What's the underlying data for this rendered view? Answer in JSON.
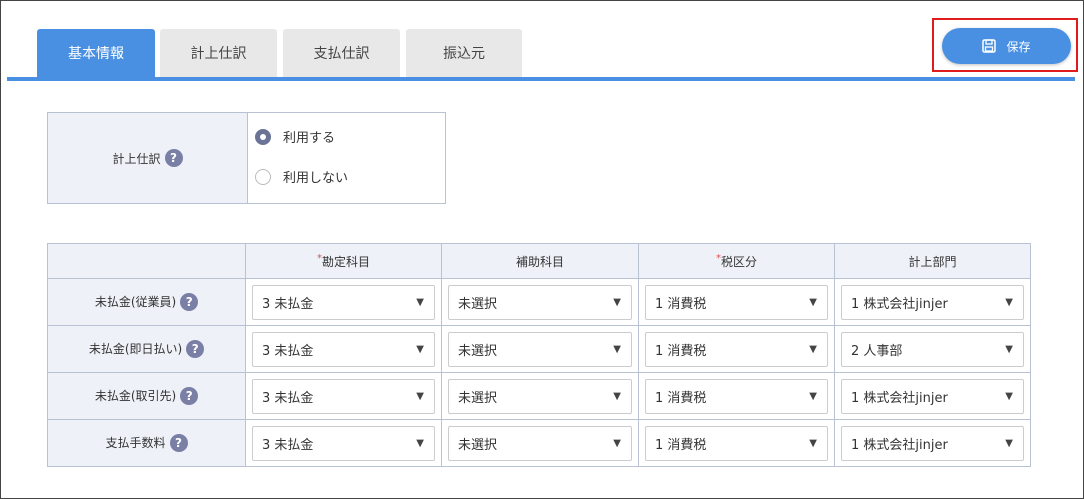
{
  "tabs": [
    {
      "label": "基本情報",
      "active": true
    },
    {
      "label": "計上仕訳",
      "active": false
    },
    {
      "label": "支払仕訳",
      "active": false
    },
    {
      "label": "振込元",
      "active": false
    }
  ],
  "save_button": {
    "label": "保存",
    "icon": "save-icon"
  },
  "accounting_entry": {
    "label": "計上仕訳",
    "options": [
      {
        "label": "利用する",
        "selected": true
      },
      {
        "label": "利用しない",
        "selected": false
      }
    ]
  },
  "table": {
    "headers": [
      {
        "label": "",
        "required": false
      },
      {
        "label": "勘定科目",
        "required": true
      },
      {
        "label": "補助科目",
        "required": false
      },
      {
        "label": "税区分",
        "required": true
      },
      {
        "label": "計上部門",
        "required": false
      }
    ],
    "required_mark": "*",
    "rows": [
      {
        "label": "未払金(従業員)",
        "cells": [
          "3 未払金",
          "未選択",
          "1 消費税",
          "1 株式会社jinjer"
        ]
      },
      {
        "label": "未払金(即日払い)",
        "cells": [
          "3 未払金",
          "未選択",
          "1 消費税",
          "2 人事部"
        ]
      },
      {
        "label": "未払金(取引先)",
        "cells": [
          "3 未払金",
          "未選択",
          "1 消費税",
          "1 株式会社jinjer"
        ]
      },
      {
        "label": "支払手数料",
        "cells": [
          "3 未払金",
          "未選択",
          "1 消費税",
          "1 株式会社jinjer"
        ]
      }
    ]
  },
  "help_glyph": "?",
  "caret_glyph": "▼",
  "colors": {
    "accent": "#4a90e2",
    "highlight": "#e01b1b",
    "header_bg": "#eef2f8"
  }
}
